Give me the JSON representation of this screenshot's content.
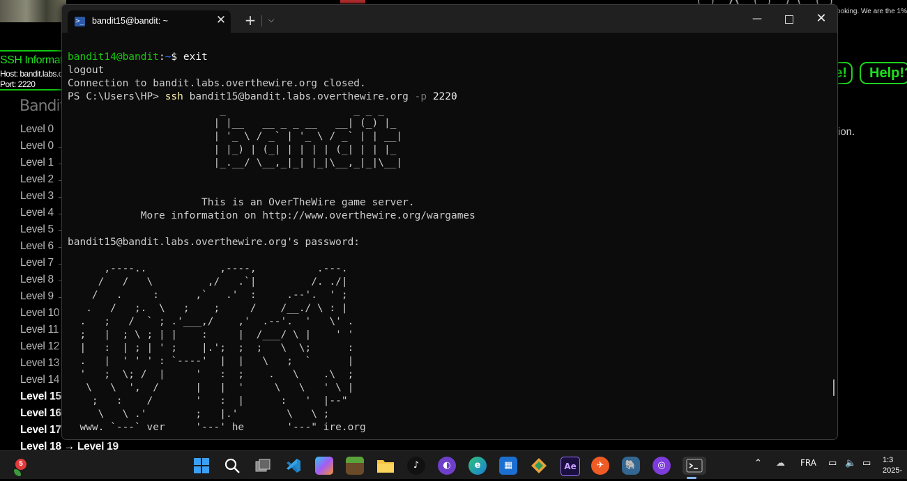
{
  "background_page": {
    "top_right_text": "ooking. We are the 1%.",
    "ssh_info": {
      "title": "SSH Informat",
      "host": "Host: bandit.labs.o",
      "port": "Port: 2220"
    },
    "heading": "Bandit",
    "levels": [
      {
        "label": "Level 0",
        "bold": false
      },
      {
        "label": "Level 0 →",
        "bold": false
      },
      {
        "label": "Level 1 →",
        "bold": false
      },
      {
        "label": "Level 2 →",
        "bold": false
      },
      {
        "label": "Level 3 →",
        "bold": false
      },
      {
        "label": "Level 4 →",
        "bold": false
      },
      {
        "label": "Level 5 →",
        "bold": false
      },
      {
        "label": "Level 6 →",
        "bold": false
      },
      {
        "label": "Level 7 →",
        "bold": false
      },
      {
        "label": "Level 8 →",
        "bold": false
      },
      {
        "label": "Level 9 →",
        "bold": false
      },
      {
        "label": "Level 10 →",
        "bold": false
      },
      {
        "label": "Level 11 →",
        "bold": false
      },
      {
        "label": "Level 12 →",
        "bold": false
      },
      {
        "label": "Level 13 →",
        "bold": false
      },
      {
        "label": "Level 14 →",
        "bold": false
      },
      {
        "label": "Level 15 →",
        "bold": true
      },
      {
        "label": "Level 16 →",
        "bold": true
      },
      {
        "label": "Level 17 →",
        "bold": true
      },
      {
        "label": "Level 18 → Level 19",
        "bold": true
      }
    ],
    "buttons": [
      "e!",
      "Help!?"
    ],
    "side_text": "ion."
  },
  "terminal": {
    "tab_title": "bandit15@bandit: ~",
    "tab_icon_glyph": ">_",
    "window_controls": {
      "minimize": "—",
      "close": "✕"
    },
    "lines": [
      [
        {
          "t": "bandit14@bandit",
          "c": "green"
        },
        {
          "t": ":",
          "c": "white"
        },
        {
          "t": "~",
          "c": "blue"
        },
        {
          "t": "$ exit",
          "c": "white"
        }
      ],
      [
        {
          "t": "logout"
        }
      ],
      [
        {
          "t": "Connection to bandit.labs.overthewire.org closed."
        }
      ],
      [
        {
          "t": "PS C:\\Users\\HP> "
        },
        {
          "t": "ssh",
          "c": "yellow"
        },
        {
          "t": " bandit15@bandit.labs.overthewire.org "
        },
        {
          "t": "-p",
          "c": "gray"
        },
        {
          "t": " 2220",
          "c": "white"
        }
      ],
      [
        {
          "t": "                         _                     _ _ _"
        }
      ],
      [
        {
          "t": "                        | |__   __ _ _ __   __| (_) |_"
        }
      ],
      [
        {
          "t": "                        | '_ \\ / _` | '_ \\ / _` | | __|"
        }
      ],
      [
        {
          "t": "                        | |_) | (_| | | | | (_| | | |_"
        }
      ],
      [
        {
          "t": "                        |_.__/ \\__,_|_| |_|\\__,_|_|\\__|"
        }
      ],
      [
        {
          "t": ""
        }
      ],
      [
        {
          "t": ""
        }
      ],
      [
        {
          "t": "                      This is an OverTheWire game server."
        }
      ],
      [
        {
          "t": "            More information on http://www.overthewire.org/wargames"
        }
      ],
      [
        {
          "t": ""
        }
      ],
      [
        {
          "t": "bandit15@bandit.labs.overthewire.org's password:"
        }
      ],
      [
        {
          "t": ""
        }
      ],
      [
        {
          "t": "      ,----..            ,----,          .---."
        }
      ],
      [
        {
          "t": "     /   /   \\         ,/   .`|         /. ./|"
        }
      ],
      [
        {
          "t": "    /   .     :      ,`   .'  :     .--'.  ' ;"
        }
      ],
      [
        {
          "t": "   .   /   ;.  \\   ;    ;     /    /__./ \\ : |"
        }
      ],
      [
        {
          "t": "  .   ;   /  ` ; .'___,/    ,'  .--'.  '   \\' ."
        }
      ],
      [
        {
          "t": "  ;   |  ; \\ ; | |    :     |  /___/ \\ |    ' '"
        }
      ],
      [
        {
          "t": "  |   :  | ; | ' ;    |.';  ;  ;   \\  \\;      :"
        }
      ],
      [
        {
          "t": "  .   |  ' ' ' : `----'  |  |   \\   ;  `      |"
        }
      ],
      [
        {
          "t": "  '   ;  \\; /  |     '   :  ;    .   \\    .\\  ;"
        }
      ],
      [
        {
          "t": "   \\   \\  ',  /      |   |  '     \\   \\   ' \\ |"
        }
      ],
      [
        {
          "t": "    ;   :    /       '   :  |      :   '  |--\""
        }
      ],
      [
        {
          "t": "     \\   \\ .'        ;   |.'        \\   \\ ;"
        }
      ],
      [
        {
          "t": "  www. `---` ver     '---' he       '---\" ire.org"
        }
      ]
    ]
  },
  "taskbar": {
    "widget_badge": "5",
    "keyboard_language": "FRA",
    "clock": {
      "time": "1:3",
      "date": "2025-"
    },
    "apps": [
      "windows-start",
      "search",
      "task-view",
      "vscode",
      "copilot",
      "minecraft",
      "file-explorer",
      "tiktok",
      "github",
      "edge",
      "microsoft-store",
      "git-tool",
      "after-effects",
      "postman",
      "pgadmin",
      "tor-browser",
      "terminal"
    ]
  }
}
